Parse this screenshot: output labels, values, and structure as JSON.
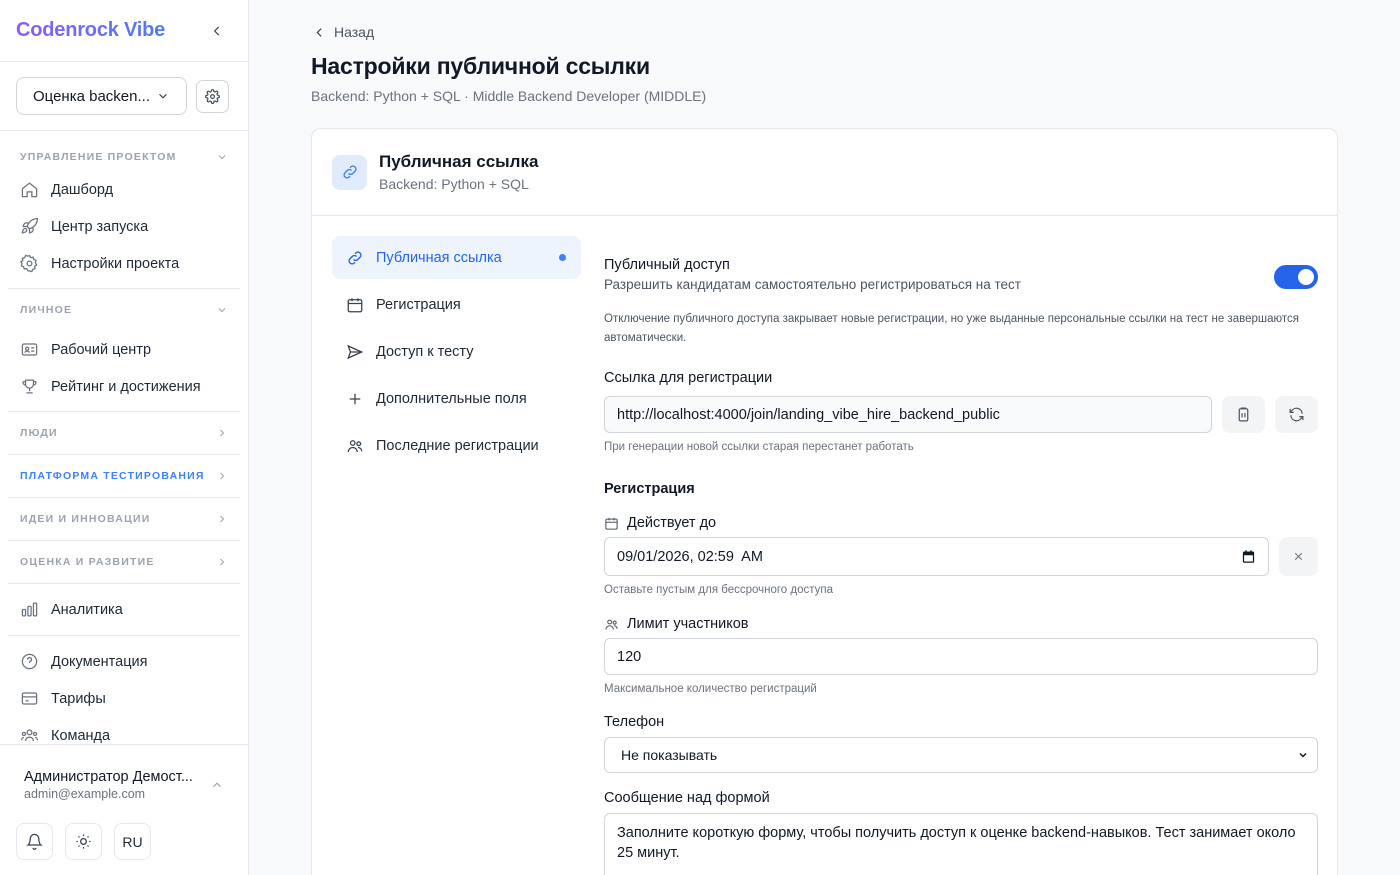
{
  "sidebar": {
    "brand": "Codenrock Vibe",
    "project_select": "Оценка backen...",
    "sections": {
      "project": {
        "title": "Управление проектом",
        "items": [
          "Дашборд",
          "Центр запуска",
          "Настройки проекта"
        ]
      },
      "personal": {
        "title": "Личное",
        "items": [
          "Рабочий центр",
          "Рейтинг и достижения"
        ]
      },
      "people": {
        "title": "Люди"
      },
      "testing": {
        "title": "Платформа тестирования"
      },
      "ideas": {
        "title": "Идеи и инновации"
      },
      "assessment": {
        "title": "Оценка и развитие"
      },
      "analytics": {
        "label": "Аналитика"
      },
      "misc": {
        "items": [
          "Документация",
          "Тарифы",
          "Команда"
        ]
      }
    },
    "user": {
      "name": "Администратор Демост...",
      "email": "admin@example.com",
      "language": "RU"
    }
  },
  "header": {
    "back_label": "Назад",
    "title": "Настройки публичной ссылки",
    "subtitle": "Backend: Python + SQL · Middle Backend Developer (MIDDLE)"
  },
  "card": {
    "title": "Публичная ссылка",
    "subtitle": "Backend: Python + SQL",
    "tabs": [
      "Публичная ссылка",
      "Регистрация",
      "Доступ к тесту",
      "Дополнительные поля",
      "Последние регистрации"
    ]
  },
  "form": {
    "public_access": {
      "label": "Публичный доступ",
      "description": "Разрешить кандидатам самостоятельно регистрироваться на тест",
      "enabled": true,
      "note": "Отключение публичного доступа закрывает новые регистрации, но уже выданные персональные ссылки на тест не завершаются автоматически."
    },
    "registration_link": {
      "label": "Ссылка для регистрации",
      "value": "http://localhost:4000/join/landing_vibe_hire_backend_public",
      "hint": "При генерации новой ссылки старая перестанет работать"
    },
    "registration": {
      "heading": "Регистрация",
      "valid_until": {
        "label": "Действует до",
        "value": "09/01/2026, 02:59  AM",
        "hint": "Оставьте пустым для бессрочного доступа"
      },
      "limit": {
        "label": "Лимит участников",
        "value": "120",
        "hint": "Максимальное количество регистраций"
      },
      "phone": {
        "label": "Телефон",
        "value": "Не показывать"
      },
      "message": {
        "label": "Сообщение над формой",
        "value": "Заполните короткую форму, чтобы получить доступ к оценке backend-навыков. Тест занимает около 25 минут."
      }
    }
  },
  "colors": {
    "accent": "#2563eb",
    "brand_gradient_start": "#8b5cf6",
    "brand_gradient_end": "#4f7cf0"
  }
}
